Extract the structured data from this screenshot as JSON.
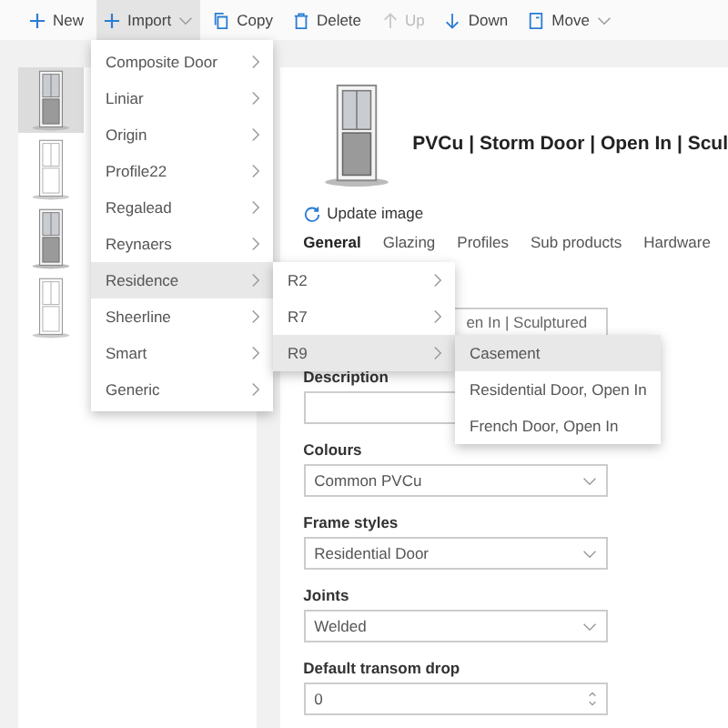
{
  "toolbar": [
    {
      "kind": "plus",
      "label": "New",
      "disabled": false,
      "expanded": false,
      "dropdown": false
    },
    {
      "kind": "plus",
      "label": "Import",
      "disabled": false,
      "expanded": true,
      "dropdown": true
    },
    {
      "kind": "copy",
      "label": "Copy",
      "disabled": false,
      "expanded": false,
      "dropdown": false
    },
    {
      "kind": "delete",
      "label": "Delete",
      "disabled": false,
      "expanded": false,
      "dropdown": false
    },
    {
      "kind": "up",
      "label": "Up",
      "disabled": true,
      "expanded": false,
      "dropdown": false
    },
    {
      "kind": "down",
      "label": "Down",
      "disabled": false,
      "expanded": false,
      "dropdown": false
    },
    {
      "kind": "move",
      "label": "Move",
      "disabled": false,
      "expanded": false,
      "dropdown": true
    }
  ],
  "thumbnails": [
    {
      "kind": "door",
      "selected": true
    },
    {
      "kind": "frame",
      "selected": false
    },
    {
      "kind": "door",
      "selected": false
    },
    {
      "kind": "frame",
      "selected": false
    }
  ],
  "detail": {
    "title": "PVCu | Storm Door | Open In | Scul",
    "update_image": "Update image",
    "tabs": [
      {
        "label": "General",
        "selected": true
      },
      {
        "label": "Glazing",
        "selected": false
      },
      {
        "label": "Profiles",
        "selected": false
      },
      {
        "label": "Sub products",
        "selected": false
      },
      {
        "label": "Hardware",
        "selected": false
      }
    ],
    "name_value": "en In | Sculptured",
    "fields": [
      {
        "kind": "input",
        "label": "Description"
      },
      {
        "kind": "select",
        "label": "Colours",
        "value": "Common PVCu"
      },
      {
        "kind": "select",
        "label": "Frame styles",
        "value": "Residential Door"
      },
      {
        "kind": "select",
        "label": "Joints",
        "value": "Welded"
      },
      {
        "kind": "number",
        "label": "Default transom drop",
        "value": "0"
      }
    ]
  },
  "import_menu": [
    {
      "label": "Composite Door",
      "selected": false
    },
    {
      "label": "Liniar",
      "selected": false
    },
    {
      "label": "Origin",
      "selected": false
    },
    {
      "label": "Profile22",
      "selected": false
    },
    {
      "label": "Regalead",
      "selected": false
    },
    {
      "label": "Reynaers",
      "selected": false
    },
    {
      "label": "Residence",
      "selected": true
    },
    {
      "label": "Sheerline",
      "selected": false
    },
    {
      "label": "Smart",
      "selected": false
    },
    {
      "label": "Generic",
      "selected": false
    }
  ],
  "residence_menu": [
    {
      "label": "R2",
      "selected": false
    },
    {
      "label": "R7",
      "selected": false
    },
    {
      "label": "R9",
      "selected": true
    }
  ],
  "r9_menu": [
    {
      "label": "Casement",
      "selected": true
    },
    {
      "label": "Residential Door, Open In",
      "selected": false
    },
    {
      "label": "French Door, Open In",
      "selected": false
    }
  ]
}
